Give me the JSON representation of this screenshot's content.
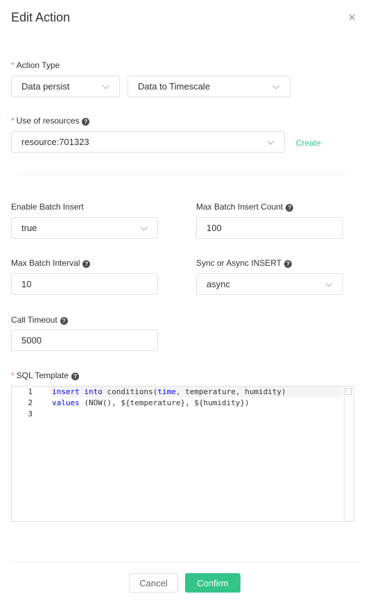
{
  "dialog": {
    "title": "Edit Action",
    "close_icon": "×"
  },
  "action_type": {
    "label": "Action Type",
    "required_mark": "*",
    "category": "Data persist",
    "target": "Data to Timescale"
  },
  "resources": {
    "label": "Use of resources",
    "required_mark": "*",
    "help": "?",
    "selected": "resource:701323",
    "create_link": "Create"
  },
  "params": {
    "enable_batch": {
      "label": "Enable Batch Insert",
      "value": "true"
    },
    "max_batch_count": {
      "label": "Max Batch Insert Count",
      "help": "?",
      "value": "100"
    },
    "max_batch_interval": {
      "label": "Max Batch Interval",
      "help": "?",
      "value": "10"
    },
    "sync_async": {
      "label": "Sync or Async INSERT",
      "help": "?",
      "value": "async"
    },
    "call_timeout": {
      "label": "Call Timeout",
      "help": "?",
      "value": "5000"
    }
  },
  "sql_template": {
    "label": "SQL Template",
    "required_mark": "*",
    "help": "?",
    "line_numbers": [
      "1",
      "2",
      "3"
    ],
    "line1": {
      "kw1": "insert",
      "kw2": "into",
      "t1": " conditions(",
      "fn": "time",
      "t2": ", temperature, humidity)"
    },
    "line2": {
      "kw": "values",
      "t": " (NOW(), ${temperature}, ${humidity})"
    }
  },
  "footer": {
    "cancel_label": "Cancel",
    "confirm_label": "Confirm"
  },
  "colors": {
    "accent": "#34c388",
    "required": "#f56c6c",
    "border": "#dcdfe6"
  }
}
